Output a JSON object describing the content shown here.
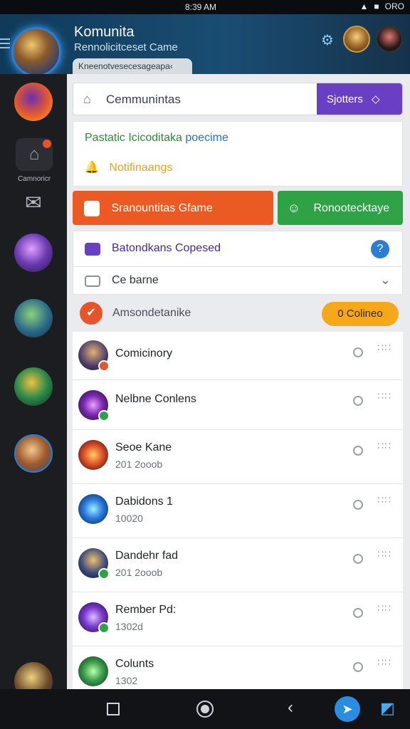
{
  "status_bar": {
    "time": "8:39 AM",
    "battery": "ORO"
  },
  "header": {
    "title": "Komunita",
    "subtitle": "Rennolicitceset Came",
    "pill": "Kneenotvesecesageapa‹"
  },
  "sidebar": {
    "label": "Camnoricr"
  },
  "search": {
    "placeholder": "Cemmunintas",
    "button": "Sjotters"
  },
  "notice": {
    "line1_green": "Pastatic Icicoditaka",
    "line1_blue": "poecime",
    "line2": "Notifinaangs"
  },
  "actions": {
    "orange": "Sranountitas Gfame",
    "green": "Ronootecktaye"
  },
  "section_row": {
    "label": "Batondkans Copesed"
  },
  "select_row": {
    "label": "Ce barne"
  },
  "group": {
    "label": "Amsondetanike",
    "pill": "0 Colineo"
  },
  "list": [
    {
      "name": "Comicinory",
      "sub": ""
    },
    {
      "name": "Nelbne Conlens",
      "sub": ""
    },
    {
      "name": "Seoe Kane",
      "sub": "201 2ooob"
    },
    {
      "name": "Dabidons 1",
      "sub": "10020"
    },
    {
      "name": "Dandehr fad",
      "sub": "201 2ooob"
    },
    {
      "name": "Rember Pd:",
      "sub": "1302d"
    },
    {
      "name": "Colunts",
      "sub": "1302"
    }
  ],
  "colors": {
    "header": "#1a4d73",
    "accent_purple": "#6a3fc4",
    "accent_orange": "#ec5a24",
    "accent_green": "#2ea244",
    "pill_yellow": "#f7a818",
    "help_blue": "#2a7ed6"
  }
}
